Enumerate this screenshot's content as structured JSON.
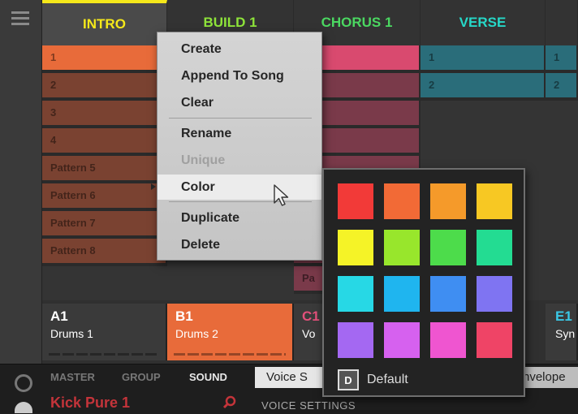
{
  "scenes": [
    {
      "label": "INTRO",
      "color": "#f5e81a",
      "selected": true
    },
    {
      "label": "BUILD 1",
      "color": "#8ee33a"
    },
    {
      "label": "CHORUS 1",
      "color": "#4bd861"
    },
    {
      "label": "VERSE",
      "color": "#26d8c8"
    }
  ],
  "patterns": {
    "col_a": [
      "1",
      "2",
      "3",
      "4",
      "Pattern 5",
      "Pattern 6",
      "Pattern 7",
      "Pattern 8"
    ],
    "col_d": [
      "1",
      "2"
    ],
    "col_e": [
      "1",
      "2"
    ],
    "col_c_partial": "Pa"
  },
  "groups": [
    {
      "name": "A1",
      "desc": "Drums 1"
    },
    {
      "name": "B1",
      "desc": "Drums 2"
    },
    {
      "name": "C1",
      "desc": "Vo"
    },
    {
      "name": "E1",
      "desc": "Syn"
    }
  ],
  "bottom": {
    "tabs": [
      "MASTER",
      "GROUP",
      "SOUND"
    ],
    "sound_name": "Kick Pure 1",
    "voice_tab": "Voice S",
    "envelope_tab": "nvelope",
    "voice_settings": "VOICE SETTINGS"
  },
  "context_menu": {
    "items": [
      {
        "label": "Create"
      },
      {
        "label": "Append To Song"
      },
      {
        "label": "Clear"
      },
      {
        "label": "Rename"
      },
      {
        "label": "Unique",
        "disabled": true
      },
      {
        "label": "Color",
        "submenu": true,
        "highlighted": true
      },
      {
        "label": "Duplicate"
      },
      {
        "label": "Delete"
      }
    ]
  },
  "palette": {
    "colors": [
      "#f23a38",
      "#f26a36",
      "#f59a2a",
      "#f7c823",
      "#f5f327",
      "#98e62c",
      "#4ddc4b",
      "#23dc92",
      "#27d8e5",
      "#1fb5ef",
      "#3f8ef2",
      "#7f74f2",
      "#a468f2",
      "#d661ef",
      "#ef55d0",
      "#ef4466"
    ],
    "default_badge": "D",
    "default_label": "Default"
  },
  "colors": {
    "pattern_orange": "#e86b3a",
    "pattern_brown": "#7a4231",
    "pattern_pink": "#d94a6f",
    "pattern_pink_dark": "#7a3a4a",
    "pattern_teal": "#2a6d7a",
    "group_orange": "#e86b3a"
  }
}
